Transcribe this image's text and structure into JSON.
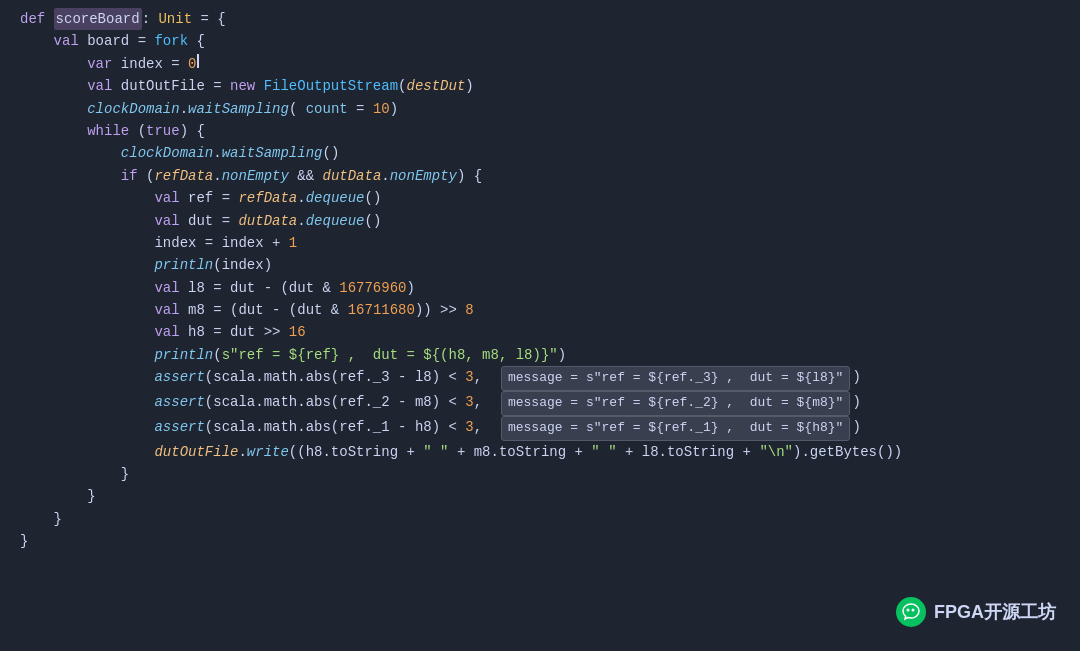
{
  "code": {
    "lines": [
      {
        "indent": 0,
        "content": "def_scoreBoard_Unit_open"
      },
      {
        "indent": 1,
        "content": "val_board_fork_open"
      },
      {
        "indent": 2,
        "content": "var_index_0"
      },
      {
        "indent": 2,
        "content": "val_dutOutFile"
      },
      {
        "indent": 2,
        "content": "clockDomain_waitSampling"
      },
      {
        "indent": 2,
        "content": "while_true_open"
      },
      {
        "indent": 3,
        "content": "clockDomain_waitSampling2"
      },
      {
        "indent": 3,
        "content": "if_nonEmpty_open"
      },
      {
        "indent": 4,
        "content": "val_ref"
      },
      {
        "indent": 4,
        "content": "val_dut"
      },
      {
        "indent": 4,
        "content": "index_increment"
      },
      {
        "indent": 4,
        "content": "println_index"
      },
      {
        "indent": 4,
        "content": "val_l8"
      },
      {
        "indent": 4,
        "content": "val_m8"
      },
      {
        "indent": 4,
        "content": "val_h8"
      },
      {
        "indent": 4,
        "content": "println_str"
      },
      {
        "indent": 4,
        "content": "assert_l8"
      },
      {
        "indent": 4,
        "content": "assert_m8"
      },
      {
        "indent": 4,
        "content": "assert_h8"
      },
      {
        "indent": 4,
        "content": "dutOutFile_write"
      },
      {
        "indent": 3,
        "content": "close_brace"
      },
      {
        "indent": 2,
        "content": "close_brace"
      },
      {
        "indent": 1,
        "content": "close_brace"
      },
      {
        "indent": 0,
        "content": "close_brace"
      }
    ]
  },
  "watermark": {
    "text": "FPGA开源工坊"
  }
}
